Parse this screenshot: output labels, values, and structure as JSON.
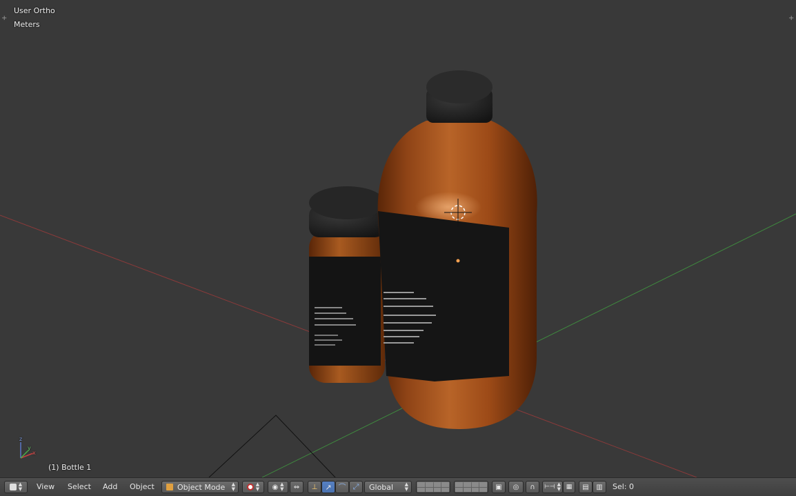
{
  "viewport": {
    "view_name": "User Ortho",
    "units": "Meters",
    "active_object": "(1) Bottle 1",
    "axis_gizmo": {
      "x": "x",
      "y": "y",
      "z": "z"
    }
  },
  "colors": {
    "background": "#393939",
    "x_axis": "#8a3a3a",
    "y_axis": "#3f8a3f",
    "bottle_body": "#a24d18",
    "cap": "#1e1e1e",
    "label": "#151515",
    "accent_blue": "#5680c2"
  },
  "header": {
    "editor_type_icon": "cube-icon",
    "menus": [
      "View",
      "Select",
      "Add",
      "Object"
    ],
    "mode": "Object Mode",
    "transform_orientation": "Global",
    "selection_count": "Sel: 0"
  }
}
